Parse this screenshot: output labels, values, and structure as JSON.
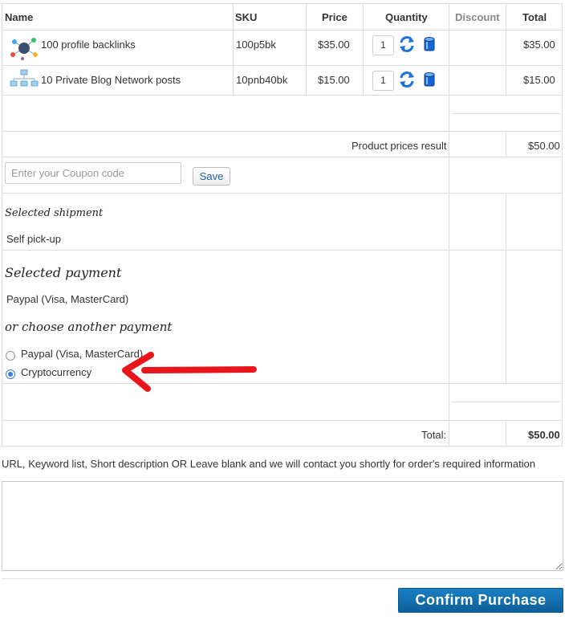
{
  "table": {
    "headers": {
      "name": "Name",
      "sku": "SKU",
      "price": "Price",
      "quantity": "Quantity",
      "discount": "Discount",
      "total": "Total"
    },
    "rows": [
      {
        "name": "100 profile backlinks",
        "sku": "100p5bk",
        "price": "$35.00",
        "qty": "1",
        "total": "$35.00",
        "thumb_icon": "backlinks-network-icon"
      },
      {
        "name": "10 Private Blog Network posts",
        "sku": "10pnb40bk",
        "price": "$15.00",
        "qty": "1",
        "total": "$15.00",
        "thumb_icon": "blog-network-icon"
      }
    ],
    "product_prices_label": "Product prices result",
    "product_prices_value": "$50.00",
    "total_label": "Total:",
    "total_value": "$50.00"
  },
  "coupon": {
    "placeholder": "Enter your Coupon code",
    "save_label": "Save"
  },
  "shipment": {
    "heading": "Selected shipment",
    "value": "Self pick-up"
  },
  "payment": {
    "heading": "Selected payment",
    "value": "Paypal (Visa, MasterCard)",
    "choose_heading": "or choose another payment",
    "options": [
      {
        "label": "Paypal (Visa, MasterCard)",
        "checked": false
      },
      {
        "label": "Cryptocurrency",
        "checked": true
      }
    ]
  },
  "notes": {
    "instructions": "URL, Keyword list, Short description OR Leave blank and we will contact you shortly for order's required information",
    "value": ""
  },
  "confirm_label": "Confirm Purchase",
  "colors": {
    "link": "#1f86c0",
    "confirm_button": "#1b80c4",
    "arrow": "#e8151b",
    "border": "#dddddd"
  },
  "icons": {
    "refresh": "refresh-icon",
    "delete": "delete-icon",
    "annotation": "red-arrow-icon"
  }
}
